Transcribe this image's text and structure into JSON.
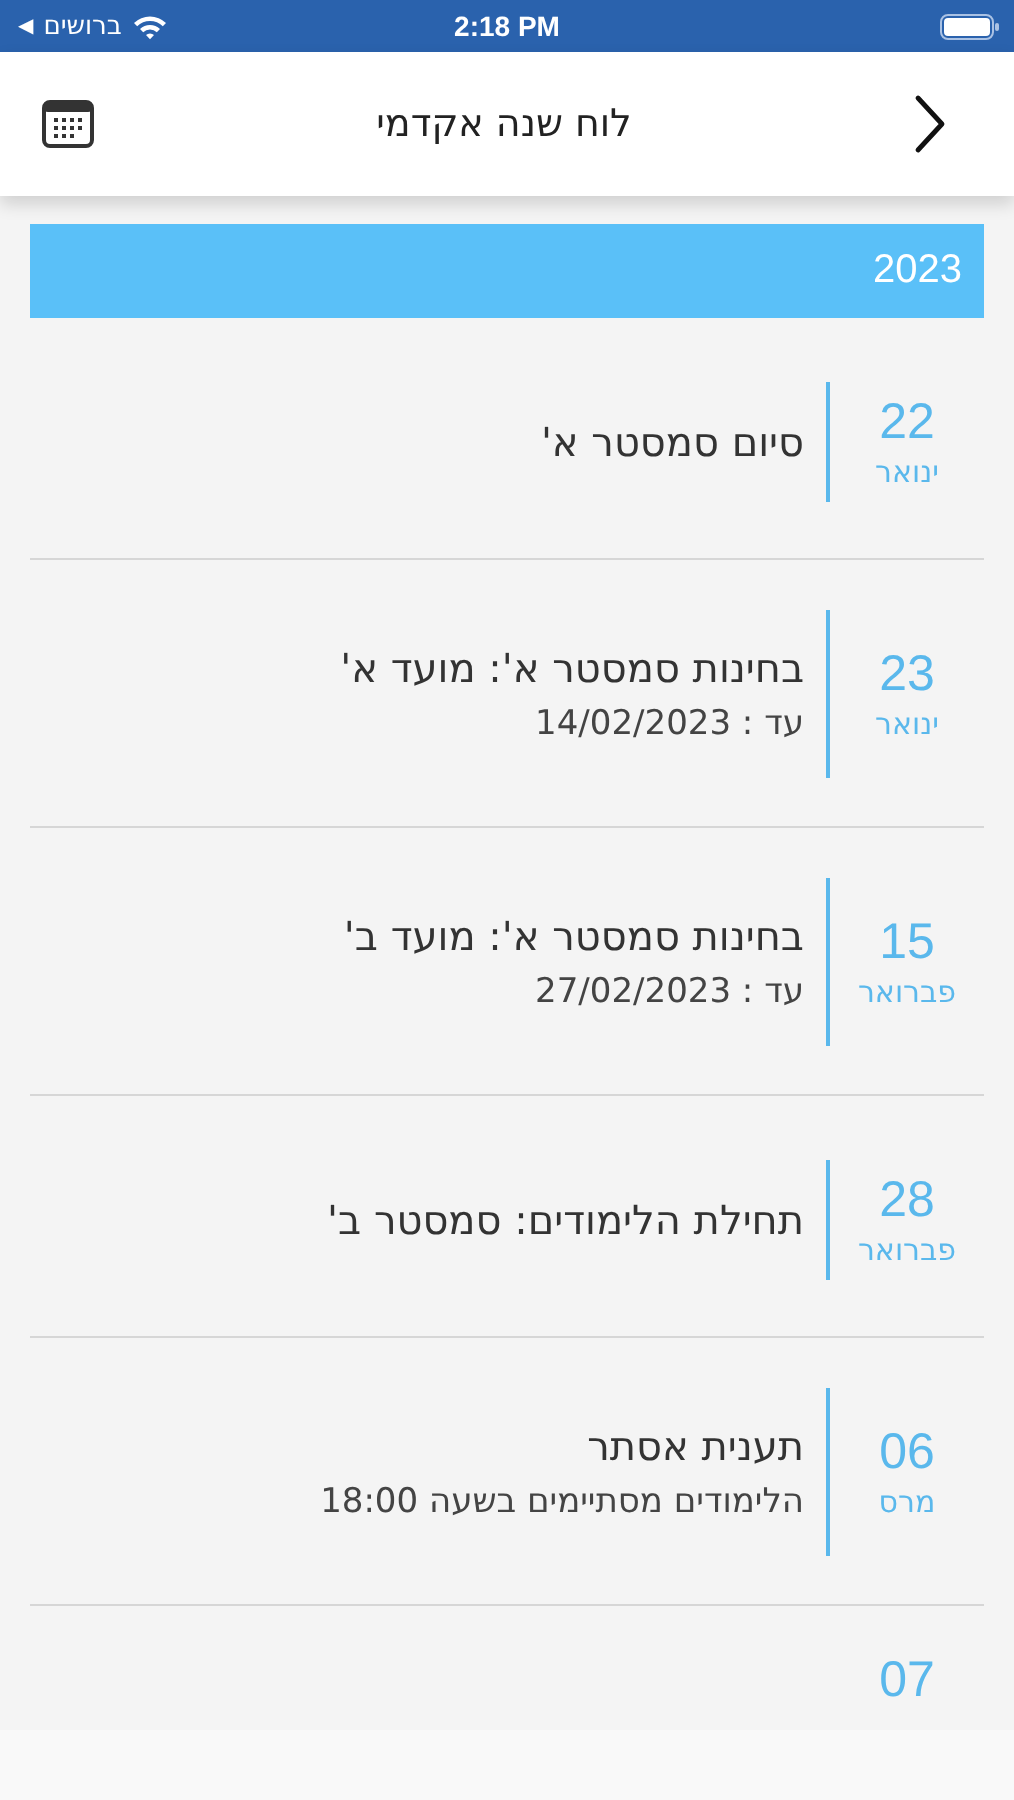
{
  "status_bar": {
    "back_arrow": "◀",
    "back_label": "ברושים",
    "time": "2:18 PM"
  },
  "header": {
    "title": "לוח שנה אקדמי"
  },
  "year": "2023",
  "events": [
    {
      "day": "22",
      "month": "ינואר",
      "title": "סיום סמסטר א'"
    },
    {
      "day": "23",
      "month": "ינואר",
      "title": "בחינות סמסטר א': מועד א'",
      "subtitle": "עד : 14/02/2023"
    },
    {
      "day": "15",
      "month": "פברואר",
      "title": "בחינות סמסטר א': מועד ב'",
      "subtitle": "עד : 27/02/2023"
    },
    {
      "day": "28",
      "month": "פברואר",
      "title": "תחילת הלימודים: סמסטר ב'"
    },
    {
      "day": "06",
      "month": "מרס",
      "title": "תענית אסתר",
      "subtitle": "הלימודים מסתיימים בשעה 18:00"
    },
    {
      "day": "07"
    }
  ]
}
